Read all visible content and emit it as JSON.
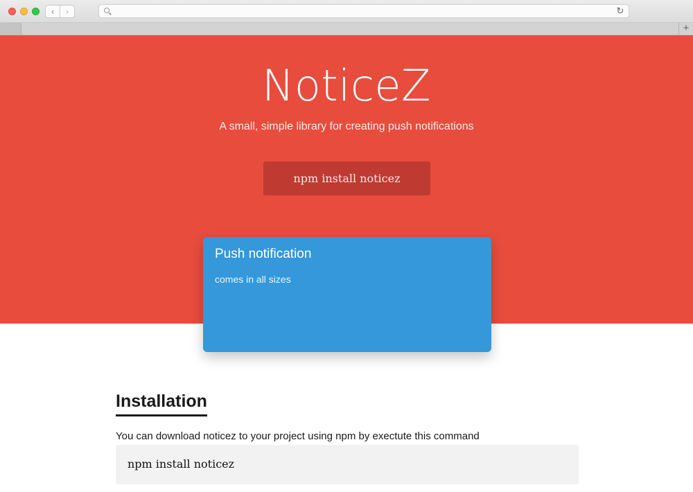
{
  "browser": {
    "back_glyph": "‹",
    "forward_glyph": "›",
    "address_value": "",
    "reload_glyph": "↻",
    "new_tab_glyph": "+",
    "icons": {
      "back": "chevron-left-icon",
      "forward": "chevron-right-icon",
      "search": "search-icon",
      "reload": "reload-icon",
      "new_tab": "plus-icon"
    }
  },
  "hero": {
    "title": "NoticeZ",
    "subtitle": "A small, simple library for creating push notifications",
    "install_command": "npm install noticez",
    "background": "#e84c3d",
    "button_color": "#bf3b31"
  },
  "notification": {
    "title": "Push notification",
    "body": "comes in all sizes",
    "color": "#3498db"
  },
  "installation": {
    "heading": "Installation",
    "description": "You can download noticez to your project using npm by exectute this command",
    "code": "npm install noticez"
  }
}
